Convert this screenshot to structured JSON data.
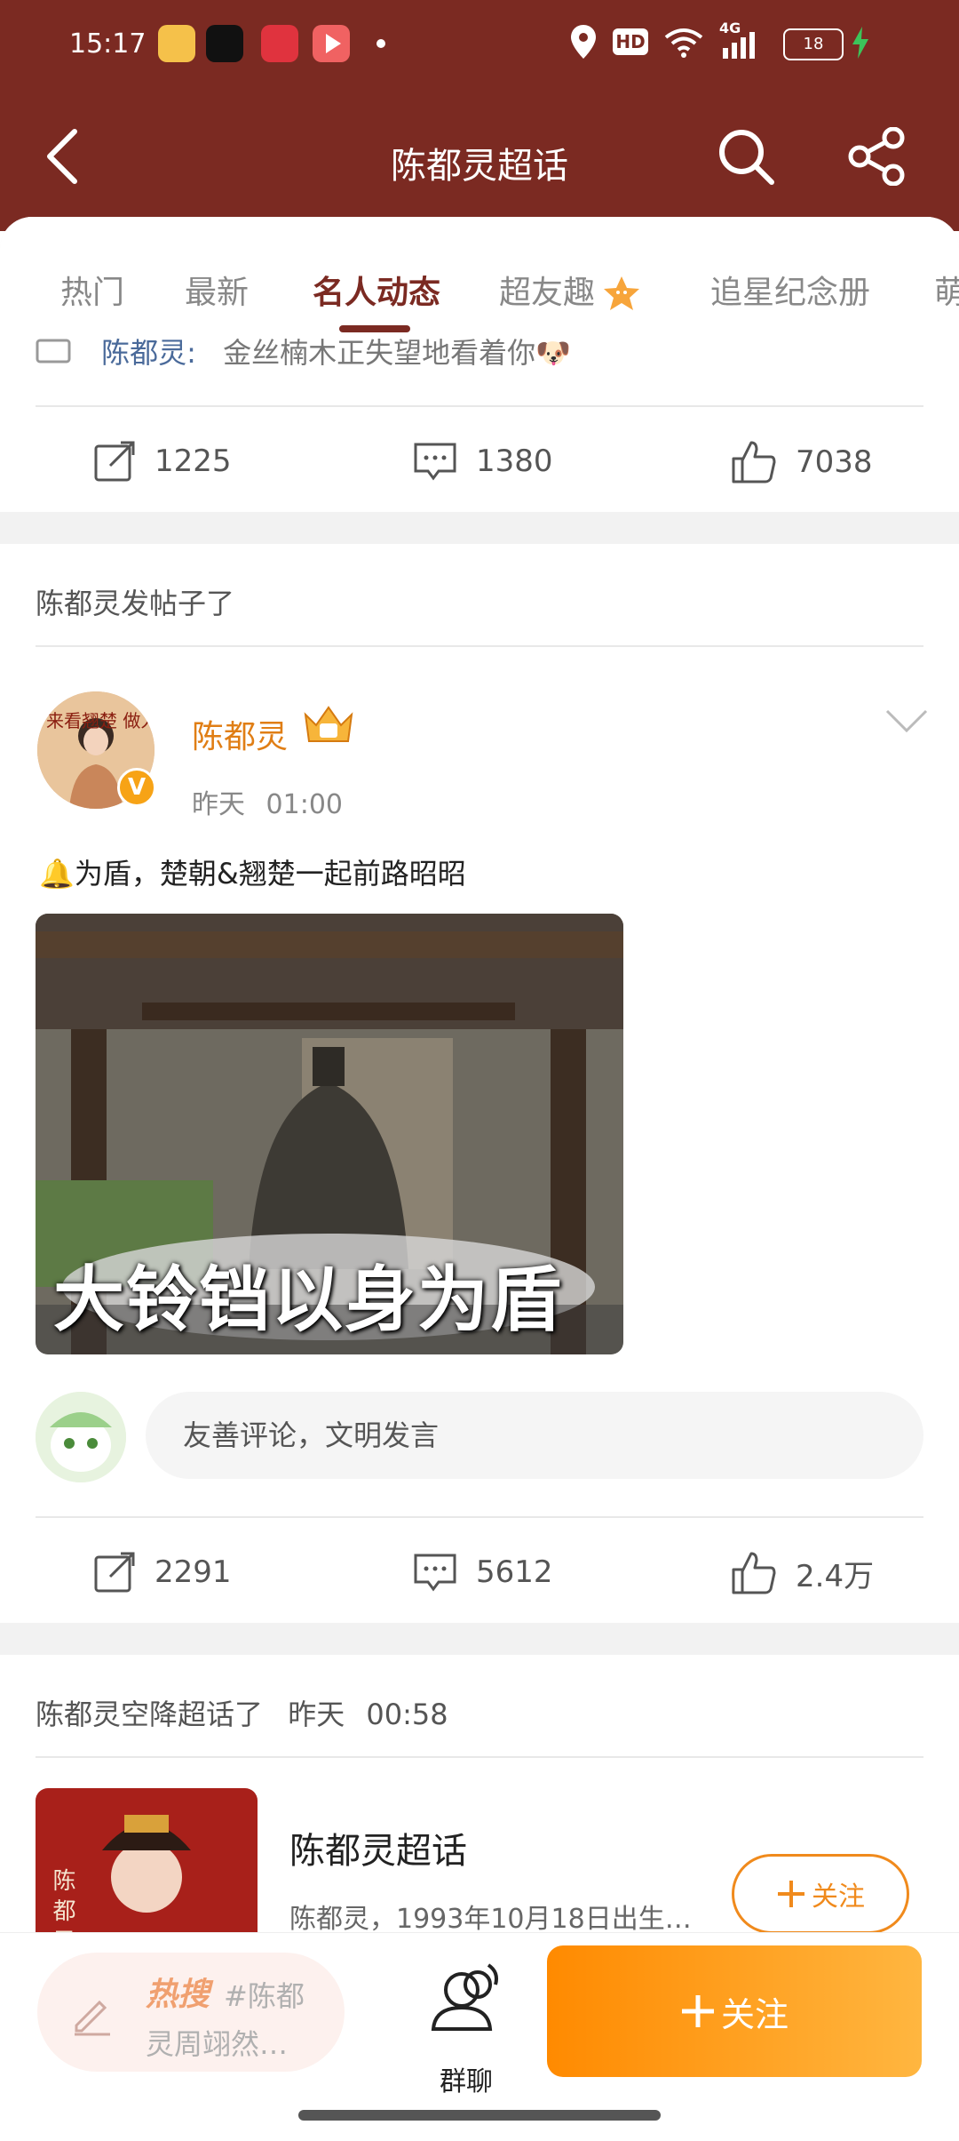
{
  "status_bar": {
    "time": "15:17",
    "battery": "18",
    "network": "4G",
    "hd": "HD"
  },
  "nav": {
    "title": "陈都灵超话"
  },
  "tabs": [
    "热门",
    "最新",
    "名人动态",
    "超友趣",
    "追星纪念册",
    "萌"
  ],
  "active_tab": 2,
  "previous_post": {
    "snippet_author": "陈都灵:",
    "snippet_text": "金丝楠木正失望地看着你🐶",
    "stats": {
      "share": "1225",
      "comment": "1380",
      "like": "7038"
    }
  },
  "post": {
    "section_title": "陈都灵发帖子了",
    "username": "陈都灵",
    "time_day": "昨天",
    "time_clock": "01:00",
    "text": "🔔为盾，楚朝&翘楚一起前路昭昭",
    "image_caption": "大铃铛以身为盾",
    "avatar_text": "来看翘楚 做人中",
    "comment_placeholder": "友善评论，文明发言",
    "stats": {
      "share": "2291",
      "comment": "5612",
      "like": "2.4万"
    }
  },
  "topic": {
    "section_title": "陈都灵空降超话了",
    "time_day": "昨天",
    "time_clock": "00:58",
    "card_title": "陈都灵超话",
    "card_desc": "陈都灵，1993年10月18日出生…",
    "cover_text": "陈 都 灵",
    "follow_label": "关注"
  },
  "bottom_bar": {
    "hot_label": "热搜",
    "hot_tag_line1": "#陈都",
    "hot_tag_line2": "灵周翊然…",
    "group_chat_label": "群聊",
    "follow_label": "关注"
  },
  "colors": {
    "header": "#7b2a22",
    "accent_orange": "#f08a1c",
    "username": "#e07e15"
  },
  "icons": [
    "back-icon",
    "search-icon",
    "share-icon",
    "repost-icon",
    "comment-icon",
    "like-icon",
    "chevron-down-icon",
    "pen-icon",
    "group-chat-icon",
    "plus-icon",
    "verified-icon",
    "crown-icon",
    "star-icon"
  ]
}
